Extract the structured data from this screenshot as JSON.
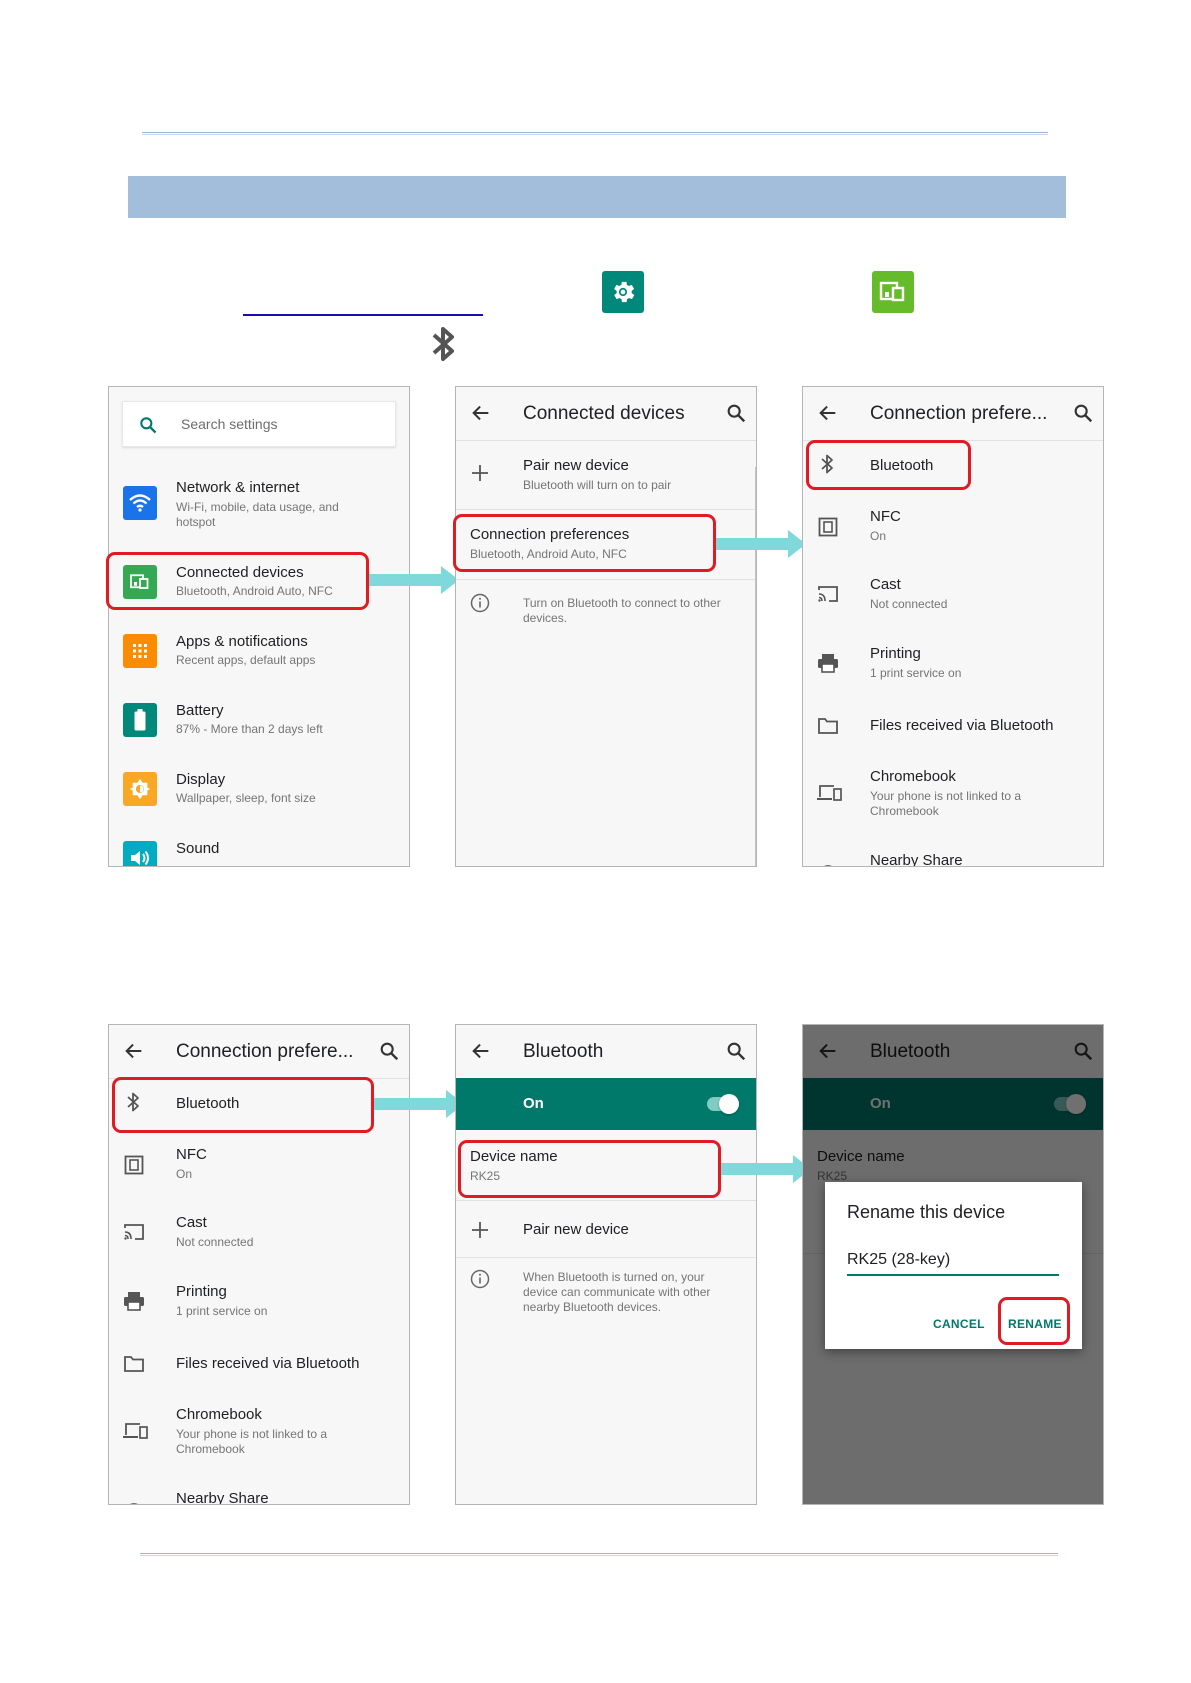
{
  "search": {
    "placeholder": "Search settings"
  },
  "settings": {
    "items": [
      {
        "title": "Network & internet",
        "subtitle": "Wi-Fi, mobile, data usage, and hotspot",
        "icon": "wifi-icon",
        "color": "#1a73e8"
      },
      {
        "title": "Connected devices",
        "subtitle": "Bluetooth, Android Auto, NFC",
        "icon": "connected-devices-icon",
        "color": "#34a853"
      },
      {
        "title": "Apps & notifications",
        "subtitle": "Recent apps, default apps",
        "icon": "apps-grid-icon",
        "color": "#fb8c00"
      },
      {
        "title": "Battery",
        "subtitle": "87% - More than 2 days left",
        "icon": "battery-icon",
        "color": "#00897b"
      },
      {
        "title": "Display",
        "subtitle": "Wallpaper, sleep, font size",
        "icon": "brightness-icon",
        "color": "#f9a825"
      },
      {
        "title": "Sound",
        "subtitle": "",
        "icon": "volume-icon",
        "color": "#00acc1"
      }
    ]
  },
  "connected_devices": {
    "title": "Connected devices",
    "pair": {
      "title": "Pair new device",
      "subtitle": "Bluetooth will turn on to pair"
    },
    "prefs": {
      "title": "Connection preferences",
      "subtitle": "Bluetooth, Android Auto, NFC"
    },
    "info": "Turn on Bluetooth to connect to other devices."
  },
  "connection_prefs": {
    "title": "Connection prefere...",
    "items": [
      {
        "title": "Bluetooth",
        "subtitle": "",
        "icon": "bluetooth-icon"
      },
      {
        "title": "NFC",
        "subtitle": "On",
        "icon": "nfc-icon"
      },
      {
        "title": "Cast",
        "subtitle": "Not connected",
        "icon": "cast-icon"
      },
      {
        "title": "Printing",
        "subtitle": "1 print service on",
        "icon": "printer-icon"
      },
      {
        "title": "Files received via Bluetooth",
        "subtitle": "",
        "icon": "folder-icon"
      },
      {
        "title": "Chromebook",
        "subtitle": "Your phone is not linked to a Chromebook",
        "icon": "chromebook-icon"
      },
      {
        "title": "Nearby Share",
        "subtitle": "",
        "icon": "nearby-share-icon"
      }
    ]
  },
  "bluetooth": {
    "title": "Bluetooth",
    "toggle_label": "On",
    "device_name_label": "Device name",
    "device_name_value": "RK25",
    "pair_label": "Pair new device",
    "info": "When Bluetooth is turned on, your device can communicate with other nearby Bluetooth devices."
  },
  "rename_dialog": {
    "title": "Rename this device",
    "input_value": "RK25 (28-key)",
    "cancel": "CANCEL",
    "rename": "RENAME"
  },
  "colors": {
    "highlight": "#e01b24",
    "arrow": "#7fd8da",
    "teal": "#00796b",
    "settings_icon": "#00897b",
    "connected_icon": "#66bb2a"
  }
}
